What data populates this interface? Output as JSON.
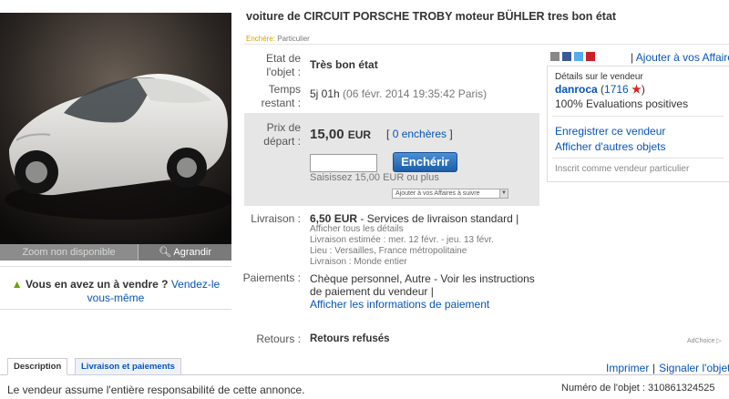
{
  "listing": {
    "title": "voiture de CIRCUIT PORSCHE TROBY moteur BÜHLER tres bon état",
    "auction_key": "Enchère:",
    "auction_value": "Particulier"
  },
  "image": {
    "zoom_unavailable": "Zoom non disponible",
    "enlarge": "Agrandir"
  },
  "sell": {
    "question": "Vous en avez un à vendre ?",
    "link": "Vendez-le vous-même"
  },
  "details": {
    "condition_label": "Etat de l'objet :",
    "condition_value": "Très bon état",
    "time_label": "Temps restant :",
    "time_value": "5j 01h",
    "time_date": "(06 févr. 2014 19:35:42 Paris)"
  },
  "bid": {
    "price_label": "Prix de départ :",
    "price": "15,00",
    "currency": "EUR",
    "bids_open": "[",
    "bids_link": "0 enchères",
    "bids_close": "]",
    "input_value": "",
    "button": "Enchérir",
    "hint": "Saisissez 15,00 EUR ou plus",
    "watch_select": "Ajouter à vos Affaires à suivre"
  },
  "shipping": {
    "label": "Livraison :",
    "cost": "6,50 EUR",
    "service": "- Services de livraison standard |",
    "all_details": "Afficher tous les détails",
    "estimated": "Livraison estimée : mer. 12 févr. - jeu. 13 févr.",
    "location": "Lieu : Versailles, France métropolitaine",
    "ships_to": "Livraison : Monde entier"
  },
  "payment": {
    "label": "Paiements :",
    "text": "Chèque personnel, Autre - Voir les instructions de paiement du vendeur |",
    "link": "Afficher les informations de paiement"
  },
  "returns": {
    "label": "Retours :",
    "value": "Retours refusés"
  },
  "adchoice": "AdChoice",
  "seller": {
    "watch_link": "Ajouter à vos Affaires",
    "title": "Détails sur le vendeur",
    "name": "danroca",
    "feedback_open": "(",
    "feedback_score": "1716",
    "feedback_close": ")",
    "positive": "100% Evaluations positives",
    "save_seller": "Enregistrer ce vendeur",
    "other_items": "Afficher d'autres objets",
    "registered": "Inscrit comme vendeur particulier"
  },
  "tabs": {
    "description": "Description",
    "shipping_payments": "Livraison et paiements"
  },
  "actions": {
    "print": "Imprimer",
    "report": "Signaler l'objet"
  },
  "footer": {
    "responsibility": "Le vendeur assume l'entière responsabilité de cette annonce.",
    "item_number_label": "Numéro de l'objet :",
    "item_number": "310861324525"
  },
  "colors": {
    "link": "#0654ba",
    "button": "#1c5ea8",
    "auction_key": "#d9a000",
    "star": "#d32b1e"
  }
}
